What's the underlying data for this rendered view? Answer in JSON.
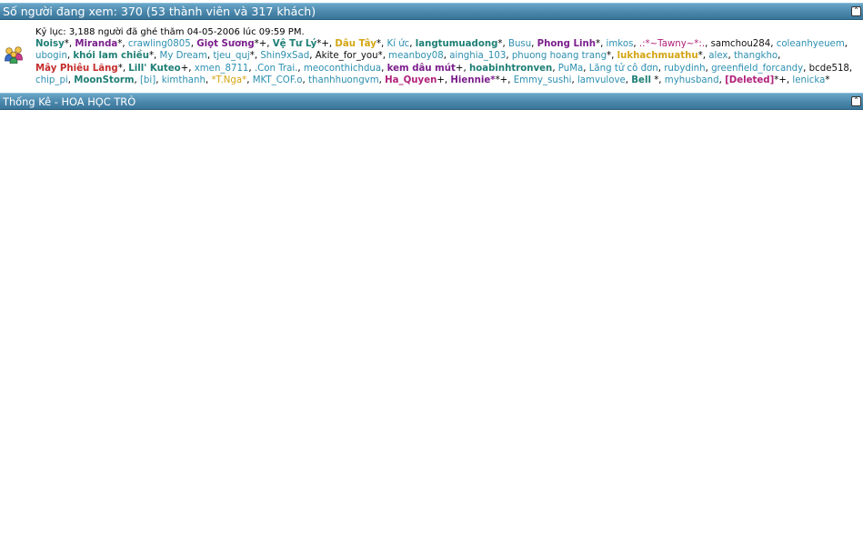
{
  "online_header": {
    "title": "Số người đang xem: 370 (53 thành viên và 317 khách)"
  },
  "record_text": "Kỷ lục: 3,188 người đã ghé thăm 04-05-2006 lúc 09:59 PM.",
  "stats_header": {
    "title": "Thống Kê - HOA HỌC TRÒ"
  },
  "collapse_glyph": "⌃",
  "colors": {
    "header_bar": "#4a87ab",
    "teal": "#1f7f76",
    "purple": "#7a1f8c",
    "gold": "#d4a514",
    "link": "#2c8fb0",
    "crimson": "#c42d2d",
    "magenta": "#b0227b",
    "green": "#0f7a38"
  },
  "users": [
    {
      "name": "Noisy",
      "suffix": "*",
      "style": "b c-teal"
    },
    {
      "name": "Miranda",
      "suffix": "*",
      "style": "b c-purple"
    },
    {
      "name": "crawling0805",
      "suffix": "",
      "style": "c-link"
    },
    {
      "name": "Giọt Sương",
      "suffix": "*+",
      "style": "b c-purple"
    },
    {
      "name": "Vệ Tư Lý",
      "suffix": "*+",
      "style": "b c-teal"
    },
    {
      "name": "Dâu Tây",
      "suffix": "*",
      "style": "b c-gold"
    },
    {
      "name": "Kí ức",
      "suffix": "",
      "style": "c-link"
    },
    {
      "name": "langtumuadong",
      "suffix": "*",
      "style": "b c-teal"
    },
    {
      "name": "Busu",
      "suffix": "",
      "style": "c-link"
    },
    {
      "name": "Phong Linh",
      "suffix": "*",
      "style": "b c-purple"
    },
    {
      "name": "imkos",
      "suffix": "",
      "style": "c-link"
    },
    {
      "name": ".:*~Tawny~*:.",
      "suffix": "",
      "style": "c-magenta"
    },
    {
      "name": "samchou284",
      "suffix": "",
      "style": "c-black"
    },
    {
      "name": "coleanhyeuem",
      "suffix": "",
      "style": "c-link"
    },
    {
      "name": "ubogin",
      "suffix": "",
      "style": "c-link"
    },
    {
      "name": "khói lam chiều",
      "suffix": "*",
      "style": "b c-teal"
    },
    {
      "name": "My Dream",
      "suffix": "",
      "style": "c-link"
    },
    {
      "name": "tjeu_quj",
      "suffix": "*",
      "style": "c-link"
    },
    {
      "name": "Shin9xSad",
      "suffix": "",
      "style": "c-link"
    },
    {
      "name": "Akite_for_you",
      "suffix": "*",
      "style": "c-black"
    },
    {
      "name": "meanboy08",
      "suffix": "",
      "style": "c-link"
    },
    {
      "name": "ainghia_103",
      "suffix": "",
      "style": "c-link"
    },
    {
      "name": "phuong hoang trang",
      "suffix": "*",
      "style": "c-link"
    },
    {
      "name": "lukhachmuathu",
      "suffix": "*",
      "style": "b c-gold"
    },
    {
      "name": "alex",
      "suffix": "",
      "style": "c-link"
    },
    {
      "name": "thangkho",
      "suffix": "",
      "style": "c-link"
    },
    {
      "name": "Mây Phiêu Lãng",
      "suffix": "*",
      "style": "b c-crimson"
    },
    {
      "name": "Lill' Kuteo",
      "suffix": "+",
      "style": "b c-teal"
    },
    {
      "name": "xmen_8711",
      "suffix": "",
      "style": "c-link"
    },
    {
      "name": ".Con Trai.",
      "suffix": "",
      "style": "c-link"
    },
    {
      "name": "meoconthichdua",
      "suffix": "",
      "style": "c-link"
    },
    {
      "name": "kem dâu mút",
      "suffix": "+",
      "style": "b c-purple"
    },
    {
      "name": "hoabinhtronven",
      "suffix": "",
      "style": "b c-teal"
    },
    {
      "name": "PuMa",
      "suffix": "",
      "style": "c-link"
    },
    {
      "name": "Lãng tử cô đơn",
      "suffix": "",
      "style": "c-link"
    },
    {
      "name": "rubydinh",
      "suffix": "",
      "style": "c-link"
    },
    {
      "name": "greenfield_forcandy",
      "suffix": "",
      "style": "c-link"
    },
    {
      "name": "bcde518",
      "suffix": "",
      "style": "c-black"
    },
    {
      "name": "chip_pi",
      "suffix": "",
      "style": "c-link"
    },
    {
      "name": "MoonStorm",
      "suffix": "",
      "style": "b c-teal"
    },
    {
      "name": "[bi]",
      "suffix": "",
      "style": "c-link"
    },
    {
      "name": "kimthanh",
      "suffix": "",
      "style": "c-link"
    },
    {
      "name": "*T.Nga*",
      "suffix": "",
      "style": "c-gold"
    },
    {
      "name": "MKT_COF.o",
      "suffix": "",
      "style": "c-link"
    },
    {
      "name": "thanhhuongvm",
      "suffix": "",
      "style": "c-link"
    },
    {
      "name": "Ha_Quyen",
      "suffix": "+",
      "style": "b c-magenta"
    },
    {
      "name": "Hiennie*",
      "suffix": "*+",
      "style": "b c-purple"
    },
    {
      "name": "Emmy_sushi",
      "suffix": "",
      "style": "c-link"
    },
    {
      "name": "lamvulove",
      "suffix": "",
      "style": "c-link"
    },
    {
      "name": "Bell",
      "suffix": " *",
      "style": "b c-teal"
    },
    {
      "name": "myhusband",
      "suffix": "",
      "style": "c-link"
    },
    {
      "name": "[Deleted]",
      "suffix": "*+",
      "style": "b c-magenta"
    },
    {
      "name": "lenicka",
      "suffix": "*",
      "style": "c-link"
    }
  ]
}
